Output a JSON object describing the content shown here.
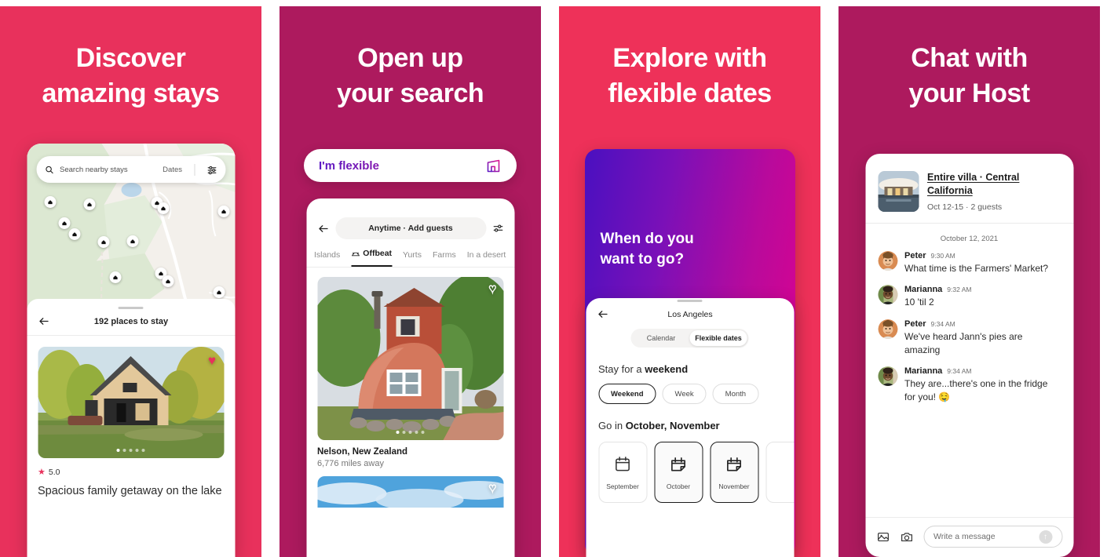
{
  "panels": [
    {
      "id": "discover",
      "bg": "#E8315C",
      "headline_line1": "Discover",
      "headline_line2": "amazing stays",
      "search": {
        "placeholder": "Search nearby stays",
        "dates_label": "Dates"
      },
      "sheet": {
        "title": "192 places to stay"
      },
      "listing": {
        "rating": "5.0",
        "title": "Spacious family getaway on the lake"
      }
    },
    {
      "id": "open-up-search",
      "bg": "#AD1A5E",
      "headline_line1": "Open up",
      "headline_line2": "your search",
      "flex_pill": {
        "label": "I'm flexible"
      },
      "topbar": {
        "pill_label": "Anytime · Add guests"
      },
      "categories": [
        "Islands",
        "Offbeat",
        "Yurts",
        "Farms",
        "In a desert"
      ],
      "active_category": "Offbeat",
      "card": {
        "title": "Nelson, New Zealand",
        "subtitle": "6,776 miles away"
      }
    },
    {
      "id": "flexible-dates",
      "bg": "#EE3159",
      "headline_line1": "Explore with",
      "headline_line2": "flexible dates",
      "gradient_question_line1": "When do you",
      "gradient_question_line2": "want to go?",
      "gradient_from": "#4A10C0",
      "gradient_to": "#E5008C",
      "topbar": {
        "title": "Los Angeles"
      },
      "segmented": {
        "options": [
          "Calendar",
          "Flexible dates"
        ],
        "selected": "Flexible dates"
      },
      "stay_label_prefix": "Stay for a ",
      "stay_label_strong": "weekend",
      "duration_chips": [
        "Weekend",
        "Week",
        "Month"
      ],
      "duration_selected": "Weekend",
      "go_label_prefix": "Go in ",
      "go_label_strong": "October, November",
      "months": [
        "September",
        "October",
        "November"
      ],
      "months_selected": [
        "October",
        "November"
      ]
    },
    {
      "id": "chat-with-host",
      "bg": "#AD1A5E",
      "headline_line1": "Chat with",
      "headline_line2": "your Host",
      "header": {
        "title": "Entire villa · Central California",
        "subtitle": "Oct 12-15 · 2 guests"
      },
      "date_divider": "October 12, 2021",
      "messages": [
        {
          "name": "Peter",
          "time": "9:30 AM",
          "text": "What time is the Farmers' Market?"
        },
        {
          "name": "Marianna",
          "time": "9:32 AM",
          "text": "10 'til 2"
        },
        {
          "name": "Peter",
          "time": "9:34 AM",
          "text": "We've heard Jann's pies are amazing"
        },
        {
          "name": "Marianna",
          "time": "9:34 AM",
          "text": "They are...there's one in the fridge for you! 🤤"
        }
      ],
      "composer": {
        "placeholder": "Write a message"
      }
    }
  ]
}
